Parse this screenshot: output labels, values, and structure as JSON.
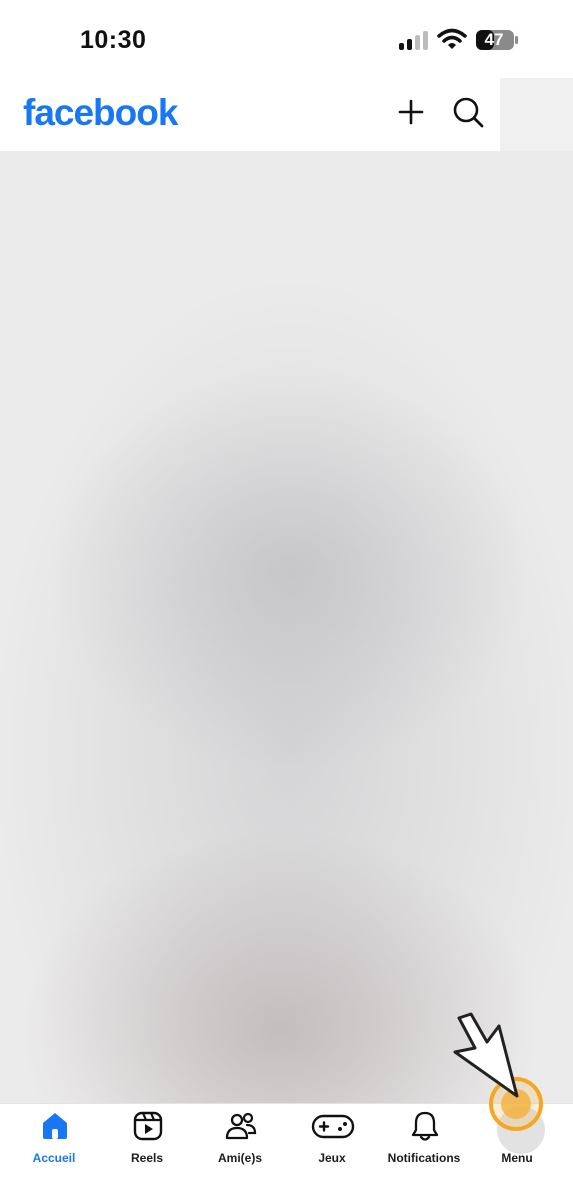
{
  "status_bar": {
    "time": "10:30",
    "battery_level": "47",
    "icons": [
      "signal-icon",
      "wifi-icon",
      "battery-icon"
    ]
  },
  "header": {
    "logo_text": "facebook",
    "icons": [
      "plus-icon",
      "search-icon"
    ]
  },
  "bottom_nav": {
    "items": [
      {
        "label": "Accueil",
        "icon": "home-icon",
        "active": true
      },
      {
        "label": "Reels",
        "icon": "reels-icon",
        "active": false
      },
      {
        "label": "Ami(e)s",
        "icon": "friends-icon",
        "active": false
      },
      {
        "label": "Jeux",
        "icon": "gamepad-icon",
        "active": false
      },
      {
        "label": "Notifications",
        "icon": "bell-icon",
        "active": false
      },
      {
        "label": "Menu",
        "icon": "menu-avatar-icon",
        "active": false
      }
    ]
  },
  "colors": {
    "brand": "#1877f2",
    "active_nav": "#1877f2",
    "text": "#1c1c1c",
    "click_highlight": "#f5a623"
  }
}
